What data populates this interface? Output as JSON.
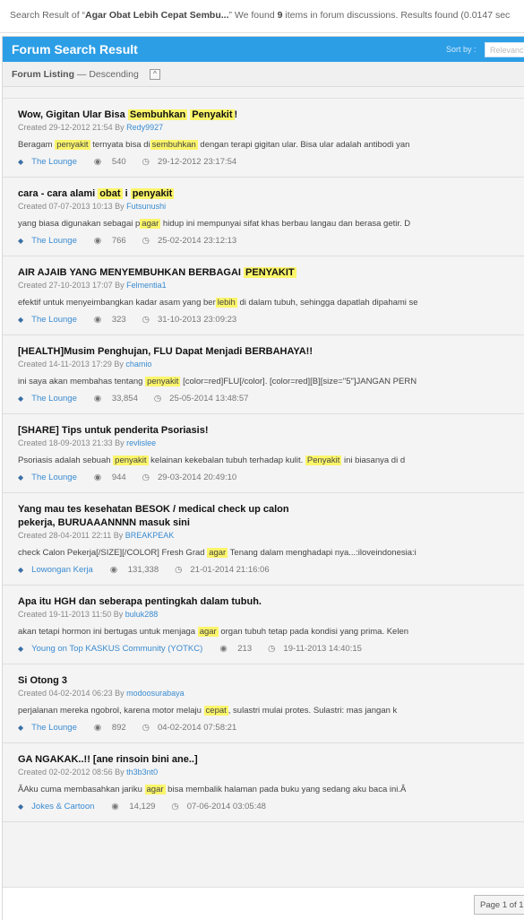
{
  "summary": {
    "prefix": "Search Result of “",
    "query": "Agar Obat Lebih Cepat Sembu...",
    "mid": "” We found ",
    "count": "9",
    "suffix": " items in forum discussions. Results found (0.0147 sec"
  },
  "header": {
    "title": "Forum Search Result",
    "sort_label": "Sort by :",
    "sort_value": "Relevance"
  },
  "listing": {
    "label": "Forum Listing",
    "order": " — Descending",
    "toggle": "^"
  },
  "results": [
    {
      "title": [
        [
          "Wow, Gigitan Ular Bisa ",
          0
        ],
        [
          "Sembuhkan",
          1
        ],
        [
          " ",
          0
        ],
        [
          "Penyakit",
          1
        ],
        [
          "!",
          0
        ]
      ],
      "created": "Created 29-12-2012 21:54 By ",
      "author": "Redy9927",
      "snippet": [
        [
          "Beragam ",
          0
        ],
        [
          "penyakit",
          1
        ],
        [
          " ternyata bisa di",
          0
        ],
        [
          "sembuhkan",
          1
        ],
        [
          " dengan terapi gigitan ular. Bisa ular adalah antibodi yan",
          0
        ]
      ],
      "forum": "The Lounge",
      "views": "540",
      "date": "29-12-2012 23:17:54"
    },
    {
      "title": [
        [
          "cara - cara alami ",
          0
        ],
        [
          "obat",
          1
        ],
        [
          " i ",
          0
        ],
        [
          "penyakit",
          1
        ]
      ],
      "created": "Created 07-07-2013 10:13 By ",
      "author": "Futsunushi",
      "snippet": [
        [
          "yang biasa digunakan sebagai p",
          0
        ],
        [
          "agar",
          1
        ],
        [
          " hidup ini mempunyai sifat khas berbau langau dan berasa getir. D",
          0
        ]
      ],
      "forum": "The Lounge",
      "views": "766",
      "date": "25-02-2014 23:12:13"
    },
    {
      "title": [
        [
          "AIR AJAIB YANG MENYEMBUHKAN BERBAGAI ",
          0
        ],
        [
          "PENYAKIT",
          1
        ]
      ],
      "created": "Created 27-10-2013 17:07 By ",
      "author": "Felmentia1",
      "snippet": [
        [
          "efektif untuk menyeimbangkan kadar asam yang ber",
          0
        ],
        [
          "lebih",
          1
        ],
        [
          " di dalam tubuh, sehingga dapatlah dipahami se",
          0
        ]
      ],
      "forum": "The Lounge",
      "views": "323",
      "date": "31-10-2013 23:09:23"
    },
    {
      "title": [
        [
          "[HEALTH]Musim Penghujan, FLU Dapat Menjadi BERBAHAYA!!",
          0
        ]
      ],
      "created": "Created 14-11-2013 17:29 By ",
      "author": "chamio",
      "snippet": [
        [
          "ini saya akan membahas tentang ",
          0
        ],
        [
          "penyakit",
          1
        ],
        [
          " [color=red]FLU[/color]. [color=red][B][size=\"5\"]JANGAN PERN",
          0
        ]
      ],
      "forum": "The Lounge",
      "views": "33,854",
      "date": "25-05-2014 13:48:57"
    },
    {
      "title": [
        [
          "[SHARE] Tips untuk penderita Psoriasis!",
          0
        ]
      ],
      "created": "Created 18-09-2013 21:33 By ",
      "author": "revlislee",
      "snippet": [
        [
          "Psoriasis adalah sebuah ",
          0
        ],
        [
          "penyakit",
          1
        ],
        [
          " kelainan kekebalan tubuh terhadap kulit. ",
          0
        ],
        [
          "Penyakit",
          1
        ],
        [
          " ini biasanya di d",
          0
        ]
      ],
      "forum": "The Lounge",
      "views": "944",
      "date": "29-03-2014 20:49:10"
    },
    {
      "title": [
        [
          "Yang mau tes kesehatan BESOK / medical check up calon pekerja, BURUAAANNNN masuk sini",
          0
        ]
      ],
      "created": "Created 28-04-2011 22:11 By ",
      "author": "BREAKPEAK",
      "snippet": [
        [
          "check Calon Pekerja[/SIZE][/COLOR] Fresh Grad ",
          0
        ],
        [
          "agar",
          1
        ],
        [
          " Tenang dalam menghadapi nya...:iloveindonesia:i",
          0
        ]
      ],
      "forum": "Lowongan Kerja",
      "views": "131,338",
      "date": "21-01-2014 21:16:06"
    },
    {
      "title": [
        [
          "Apa itu HGH dan seberapa pentingkah dalam tubuh.",
          0
        ]
      ],
      "created": "Created 19-11-2013 11:50 By ",
      "author": "buluk288",
      "snippet": [
        [
          "akan tetapi hormon ini bertugas untuk menjaga ",
          0
        ],
        [
          "agar",
          1
        ],
        [
          " organ tubuh tetap pada kondisi yang prima. Kelen",
          0
        ]
      ],
      "forum": "Young on Top KASKUS Community (YOTKC)",
      "views": "213",
      "date": "19-11-2013 14:40:15"
    },
    {
      "title": [
        [
          "Si Otong 3",
          0
        ]
      ],
      "created": "Created 04-02-2014 06:23 By ",
      "author": "modoosurabaya",
      "snippet": [
        [
          "perjalanan mereka ngobrol, karena motor melaju ",
          0
        ],
        [
          "cepat",
          1
        ],
        [
          ", sulastri mulai protes. Sulastri: mas jangan k",
          0
        ]
      ],
      "forum": "The Lounge",
      "views": "892",
      "date": "04-02-2014 07:58:21"
    },
    {
      "title": [
        [
          "GA NGAKAK..!! [ane rinsoin bini ane..]",
          0
        ]
      ],
      "created": "Created 02-02-2012 08:56 By ",
      "author": "th3b3nt0",
      "snippet": [
        [
          "ÂAku cuma membasahkan jariku ",
          0
        ],
        [
          "agar",
          1
        ],
        [
          " bisa membalik halaman pada buku yang sedang aku baca ini.Â",
          0
        ]
      ],
      "forum": "Jokes & Cartoon",
      "views": "14,129",
      "date": "07-06-2014 03:05:48"
    }
  ],
  "pagination": {
    "label": "Page 1 of 1"
  }
}
